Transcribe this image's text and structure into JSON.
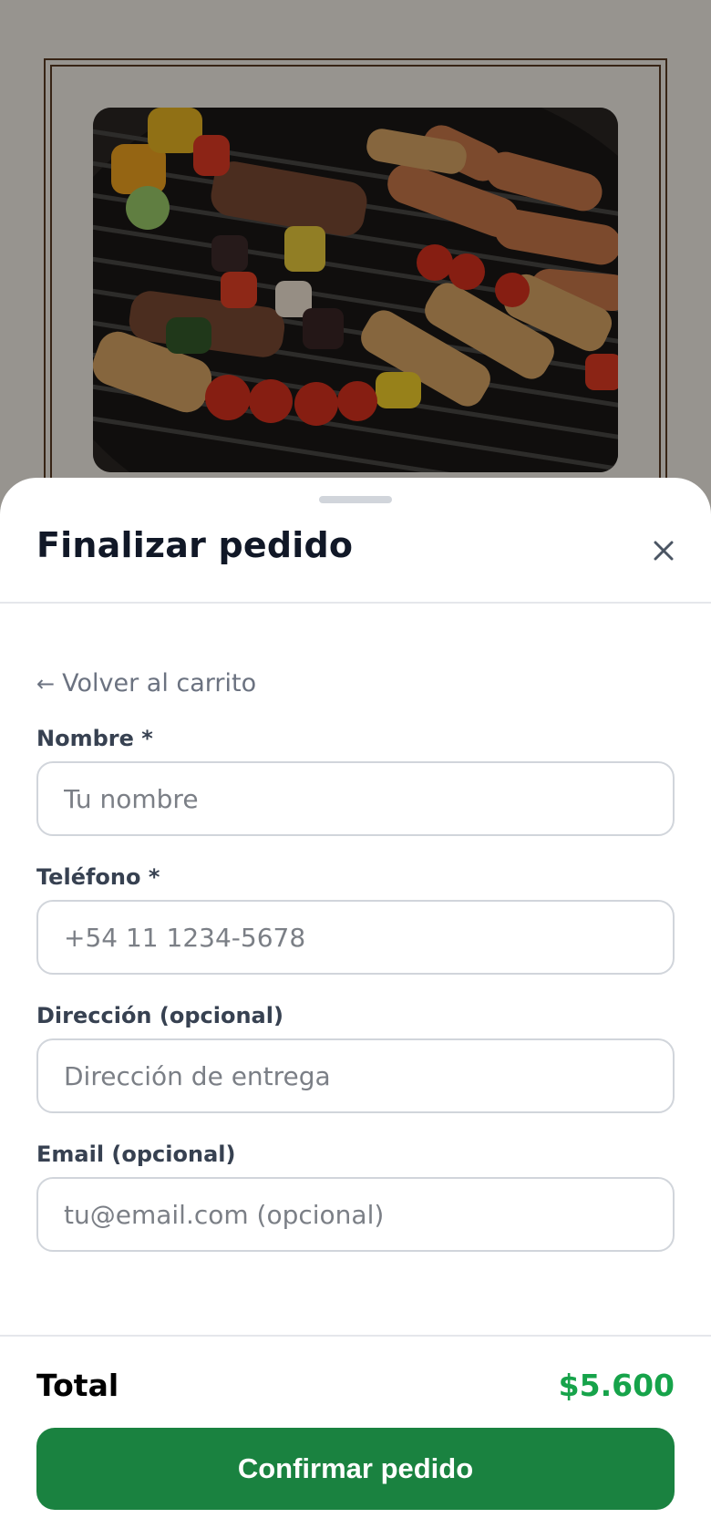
{
  "sheet": {
    "title": "Finalizar pedido",
    "close_icon": "close-icon",
    "back_link": {
      "arrow": "←",
      "label": "Volver al carrito"
    }
  },
  "form": {
    "fields": [
      {
        "label": "Nombre *",
        "placeholder": "Tu nombre",
        "value": ""
      },
      {
        "label": "Teléfono *",
        "placeholder": "+54 11 1234-5678",
        "value": ""
      },
      {
        "label": "Dirección (opcional)",
        "placeholder": "Dirección de entrega",
        "value": ""
      },
      {
        "label": "Email (opcional)",
        "placeholder": "tu@email.com (opcional)",
        "value": ""
      }
    ]
  },
  "footer": {
    "total_label": "Total",
    "total_value": "$5.600",
    "confirm_label": "Confirmar pedido"
  },
  "colors": {
    "accent": "#1a8240",
    "total": "#16a34a",
    "frame": "#5a3a22"
  }
}
